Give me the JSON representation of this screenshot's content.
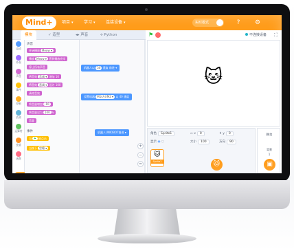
{
  "app": {
    "logo": "Mind+",
    "menu": [
      {
        "label": "项目",
        "caret": "▾"
      },
      {
        "label": "学习",
        "caret": "▾"
      },
      {
        "label": "连接设备",
        "caret": "▾"
      }
    ],
    "mode_toggle": "实时模式",
    "help_icon": "?",
    "settings_icon": "⚙"
  },
  "tabs": [
    {
      "label": "模块"
    },
    {
      "label": "✓ 造型"
    },
    {
      "label": "◂▸ 声音"
    },
    {
      "label": "⟡ Python"
    }
  ],
  "stage_bar": {
    "flag_icon": "⚑",
    "mode_label": "不连接设备",
    "fullscreen_icon": "⛶"
  },
  "categories": [
    {
      "label": "运动",
      "color": "#4c97ff"
    },
    {
      "label": "外观",
      "color": "#9966ff"
    },
    {
      "label": "声音",
      "color": "#cf63cf"
    },
    {
      "label": "事件",
      "color": "#ffbf00"
    },
    {
      "label": "控制",
      "color": "#ffab19"
    },
    {
      "label": "侦测",
      "color": "#5cb1d6"
    },
    {
      "label": "运算符",
      "color": "#59c059"
    },
    {
      "label": "变量",
      "color": "#ff8c1a"
    },
    {
      "label": "函数",
      "color": "#ff6680"
    }
  ],
  "palette": {
    "header_sound": "声音",
    "header_event": "事件",
    "blocks": [
      {
        "text": "开始播放",
        "pill": "Meow ▾",
        "cls": "sound"
      },
      {
        "text": "播放",
        "pill": "Meow ▾",
        "suffix": "直到播放完毕",
        "cls": "sound"
      },
      {
        "text": "停止所有声音",
        "pill": "",
        "cls": "sound"
      },
      {
        "text": "将音效",
        "pill": "音调 ▾",
        "suffix": "增加 10",
        "cls": "sound"
      },
      {
        "text": "将音效",
        "pill": "音调 ▾",
        "suffix": "设为 100",
        "cls": "sound"
      },
      {
        "text": "清除音效",
        "pill": "",
        "cls": "sound"
      },
      {
        "text": "将音量增加",
        "pill": "-10",
        "cls": "sound"
      },
      {
        "text": "将音量设为",
        "pill": "100",
        "suffix": "%",
        "cls": "sound"
      },
      {
        "text": "音量",
        "pill": "",
        "cls": "sound"
      },
      {
        "text": "当",
        "pill": "⚑",
        "suffix": "被点击",
        "cls": "event"
      },
      {
        "text": "当按下",
        "pill": "空格 ▾",
        "cls": "event"
      }
    ]
  },
  "scripts": [
    {
      "text": "机器人以",
      "pill": "50",
      "suffix": "速度 前进 ▾"
    },
    {
      "text": "设置机器",
      "pill": "M1(左)/M2 ▾",
      "suffix": "以 40 速度"
    },
    {
      "text": "机器人UNIOBOT前进",
      "pill": "",
      "suffix": "▾"
    }
  ],
  "zoom": {
    "in": "+",
    "out": "−",
    "reset": "="
  },
  "sprite": {
    "role_label": "角色",
    "name": "Sprite1",
    "x_label": "↔ x",
    "x": "0",
    "y_label": "↕ y",
    "y": "0",
    "show_label": "显示",
    "size_label": "大小",
    "size": "100",
    "direction_label": "方向",
    "direction": "90",
    "thumb_name": "Sprite1",
    "thumb_icon": "🐱"
  },
  "stage_cat": "🐱",
  "backdrop": {
    "title": "舞台",
    "label": "背景",
    "count": "1"
  },
  "add_sprite_icon": "🐱",
  "add_backdrop_icon": "▣",
  "extension_label": "扩展"
}
